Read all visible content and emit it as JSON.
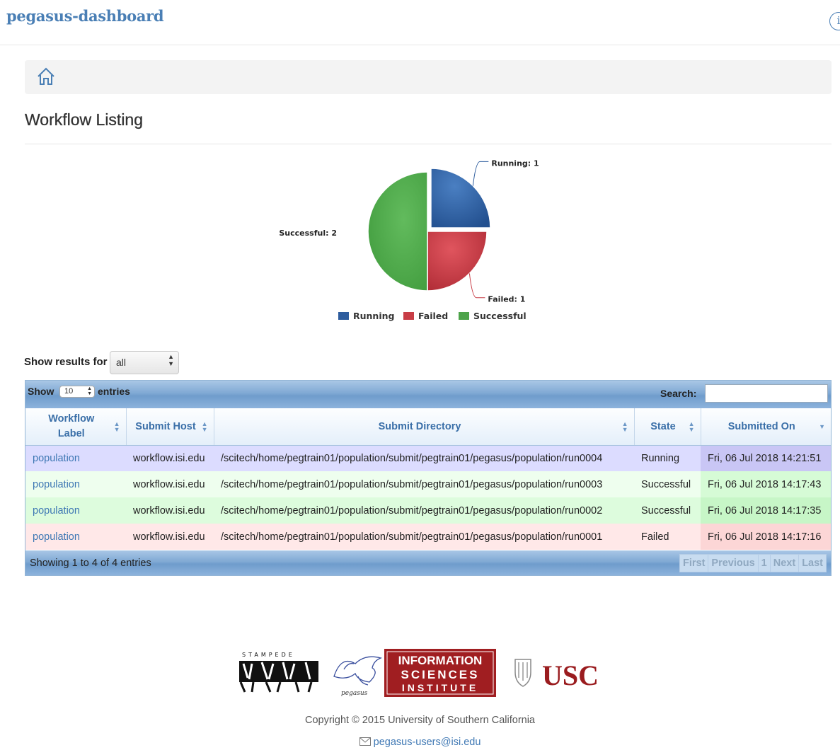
{
  "navbar": {
    "brand": "pegasus-dashboard",
    "info_icon": "info-icon",
    "info_glyph": "i"
  },
  "breadcrumb": {
    "icon": "home-icon"
  },
  "page": {
    "title": "Workflow Listing"
  },
  "chart_data": {
    "type": "pie",
    "slices": [
      {
        "label": "Running",
        "value": 1,
        "color": "#2e5d9e"
      },
      {
        "label": "Failed",
        "value": 1,
        "color": "#c83d46"
      },
      {
        "label": "Successful",
        "value": 2,
        "color": "#4da34a"
      }
    ],
    "data_labels": [
      "Running: 1",
      "Failed: 1",
      "Successful: 2"
    ],
    "legend": [
      "Running",
      "Failed",
      "Successful"
    ],
    "legend_position": "bottom"
  },
  "filter": {
    "label": "Show results for",
    "value": "all"
  },
  "table": {
    "show_label": "Show",
    "page_length": "10",
    "entries_label": "entries",
    "search_label": "Search:",
    "search_value": "",
    "columns": [
      "Workflow Label",
      "Submit Host",
      "Submit Directory",
      "State",
      "Submitted On"
    ],
    "rows": [
      {
        "label": "population",
        "host": "workflow.isi.edu",
        "dir": "/scitech/home/pegtrain01/population/submit/pegtrain01/pegasus/population/run0004",
        "state": "Running",
        "submitted": "Fri, 06 Jul 2018 14:21:51"
      },
      {
        "label": "population",
        "host": "workflow.isi.edu",
        "dir": "/scitech/home/pegtrain01/population/submit/pegtrain01/pegasus/population/run0003",
        "state": "Successful",
        "submitted": "Fri, 06 Jul 2018 14:17:43"
      },
      {
        "label": "population",
        "host": "workflow.isi.edu",
        "dir": "/scitech/home/pegtrain01/population/submit/pegtrain01/pegasus/population/run0002",
        "state": "Successful",
        "submitted": "Fri, 06 Jul 2018 14:17:35"
      },
      {
        "label": "population",
        "host": "workflow.isi.edu",
        "dir": "/scitech/home/pegtrain01/population/submit/pegtrain01/pegasus/population/run0001",
        "state": "Failed",
        "submitted": "Fri, 06 Jul 2018 14:17:16"
      }
    ],
    "info": "Showing 1 to 4 of 4 entries",
    "pagination": [
      "First",
      "Previous",
      "1",
      "Next",
      "Last"
    ]
  },
  "footer": {
    "logos": {
      "stampede": "STAMPEDE",
      "pegasus": "pegasus",
      "isi": [
        "INFORMATION",
        "SCIENCES",
        "INSTITUTE"
      ],
      "usc": "USC"
    },
    "copyright": "Copyright © 2015 University of Southern California",
    "contact_email": "pegasus-users@isi.edu",
    "contact_icon": "envelope-icon"
  }
}
